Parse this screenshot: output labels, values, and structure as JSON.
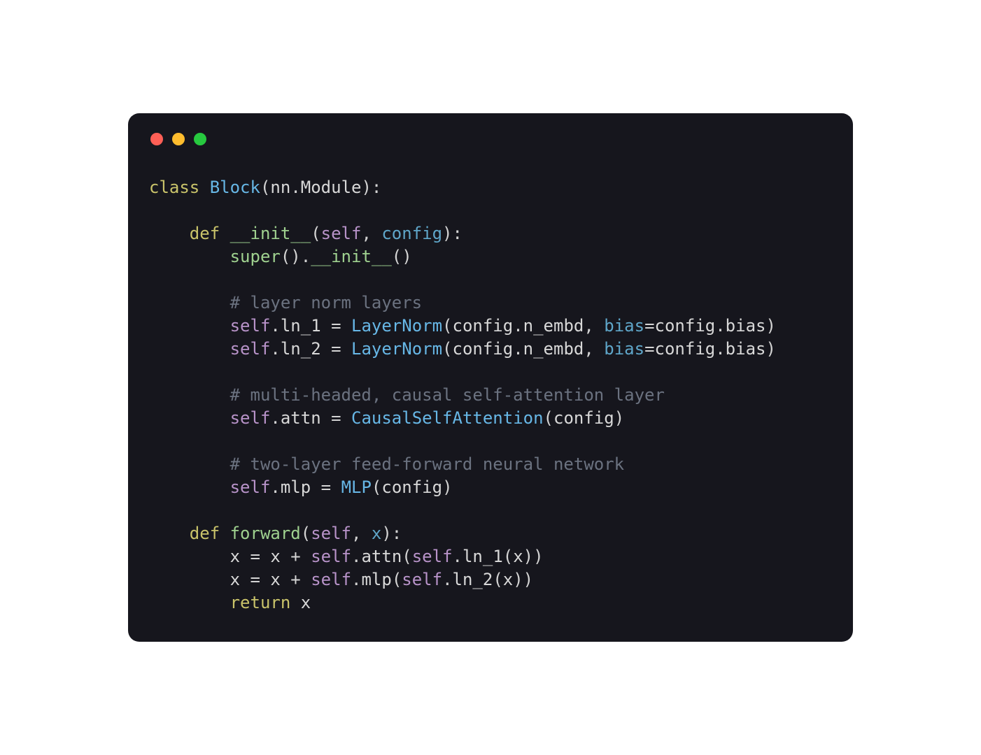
{
  "code": {
    "lines": [
      [
        {
          "t": "class ",
          "c": "kw"
        },
        {
          "t": "Block",
          "c": "cls"
        },
        {
          "t": "(",
          "c": "p"
        },
        {
          "t": "nn",
          "c": "nm"
        },
        {
          "t": ".",
          "c": "p"
        },
        {
          "t": "Module",
          "c": "nm"
        },
        {
          "t": "):",
          "c": "p"
        }
      ],
      [],
      [
        {
          "t": "    ",
          "c": "p"
        },
        {
          "t": "def ",
          "c": "kw"
        },
        {
          "t": "__init__",
          "c": "fn"
        },
        {
          "t": "(",
          "c": "p"
        },
        {
          "t": "self",
          "c": "slf"
        },
        {
          "t": ", ",
          "c": "p"
        },
        {
          "t": "config",
          "c": "prm"
        },
        {
          "t": "):",
          "c": "p"
        }
      ],
      [
        {
          "t": "        ",
          "c": "p"
        },
        {
          "t": "super",
          "c": "fn"
        },
        {
          "t": "().",
          "c": "p"
        },
        {
          "t": "__init__",
          "c": "fn"
        },
        {
          "t": "()",
          "c": "p"
        }
      ],
      [],
      [
        {
          "t": "        ",
          "c": "p"
        },
        {
          "t": "# layer norm layers",
          "c": "cm"
        }
      ],
      [
        {
          "t": "        ",
          "c": "p"
        },
        {
          "t": "self",
          "c": "slf"
        },
        {
          "t": ".",
          "c": "p"
        },
        {
          "t": "ln_1",
          "c": "nm"
        },
        {
          "t": " = ",
          "c": "op"
        },
        {
          "t": "LayerNorm",
          "c": "cls"
        },
        {
          "t": "(",
          "c": "p"
        },
        {
          "t": "config",
          "c": "nm"
        },
        {
          "t": ".",
          "c": "p"
        },
        {
          "t": "n_embd",
          "c": "nm"
        },
        {
          "t": ", ",
          "c": "p"
        },
        {
          "t": "bias",
          "c": "prm"
        },
        {
          "t": "=",
          "c": "op"
        },
        {
          "t": "config",
          "c": "nm"
        },
        {
          "t": ".",
          "c": "p"
        },
        {
          "t": "bias",
          "c": "nm"
        },
        {
          "t": ")",
          "c": "p"
        }
      ],
      [
        {
          "t": "        ",
          "c": "p"
        },
        {
          "t": "self",
          "c": "slf"
        },
        {
          "t": ".",
          "c": "p"
        },
        {
          "t": "ln_2",
          "c": "nm"
        },
        {
          "t": " = ",
          "c": "op"
        },
        {
          "t": "LayerNorm",
          "c": "cls"
        },
        {
          "t": "(",
          "c": "p"
        },
        {
          "t": "config",
          "c": "nm"
        },
        {
          "t": ".",
          "c": "p"
        },
        {
          "t": "n_embd",
          "c": "nm"
        },
        {
          "t": ", ",
          "c": "p"
        },
        {
          "t": "bias",
          "c": "prm"
        },
        {
          "t": "=",
          "c": "op"
        },
        {
          "t": "config",
          "c": "nm"
        },
        {
          "t": ".",
          "c": "p"
        },
        {
          "t": "bias",
          "c": "nm"
        },
        {
          "t": ")",
          "c": "p"
        }
      ],
      [],
      [
        {
          "t": "        ",
          "c": "p"
        },
        {
          "t": "# multi-headed, causal self-attention layer",
          "c": "cm"
        }
      ],
      [
        {
          "t": "        ",
          "c": "p"
        },
        {
          "t": "self",
          "c": "slf"
        },
        {
          "t": ".",
          "c": "p"
        },
        {
          "t": "attn",
          "c": "nm"
        },
        {
          "t": " = ",
          "c": "op"
        },
        {
          "t": "CausalSelfAttention",
          "c": "cls"
        },
        {
          "t": "(",
          "c": "p"
        },
        {
          "t": "config",
          "c": "nm"
        },
        {
          "t": ")",
          "c": "p"
        }
      ],
      [],
      [
        {
          "t": "        ",
          "c": "p"
        },
        {
          "t": "# two-layer feed-forward neural network",
          "c": "cm"
        }
      ],
      [
        {
          "t": "        ",
          "c": "p"
        },
        {
          "t": "self",
          "c": "slf"
        },
        {
          "t": ".",
          "c": "p"
        },
        {
          "t": "mlp",
          "c": "nm"
        },
        {
          "t": " = ",
          "c": "op"
        },
        {
          "t": "MLP",
          "c": "cls"
        },
        {
          "t": "(",
          "c": "p"
        },
        {
          "t": "config",
          "c": "nm"
        },
        {
          "t": ")",
          "c": "p"
        }
      ],
      [],
      [
        {
          "t": "    ",
          "c": "p"
        },
        {
          "t": "def ",
          "c": "kw"
        },
        {
          "t": "forward",
          "c": "fn"
        },
        {
          "t": "(",
          "c": "p"
        },
        {
          "t": "self",
          "c": "slf"
        },
        {
          "t": ", ",
          "c": "p"
        },
        {
          "t": "x",
          "c": "prm"
        },
        {
          "t": "):",
          "c": "p"
        }
      ],
      [
        {
          "t": "        ",
          "c": "p"
        },
        {
          "t": "x",
          "c": "nm"
        },
        {
          "t": " = ",
          "c": "op"
        },
        {
          "t": "x",
          "c": "nm"
        },
        {
          "t": " + ",
          "c": "op"
        },
        {
          "t": "self",
          "c": "slf"
        },
        {
          "t": ".",
          "c": "p"
        },
        {
          "t": "attn",
          "c": "nm"
        },
        {
          "t": "(",
          "c": "p"
        },
        {
          "t": "self",
          "c": "slf"
        },
        {
          "t": ".",
          "c": "p"
        },
        {
          "t": "ln_1",
          "c": "nm"
        },
        {
          "t": "(",
          "c": "p"
        },
        {
          "t": "x",
          "c": "nm"
        },
        {
          "t": "))",
          "c": "p"
        }
      ],
      [
        {
          "t": "        ",
          "c": "p"
        },
        {
          "t": "x",
          "c": "nm"
        },
        {
          "t": " = ",
          "c": "op"
        },
        {
          "t": "x",
          "c": "nm"
        },
        {
          "t": " + ",
          "c": "op"
        },
        {
          "t": "self",
          "c": "slf"
        },
        {
          "t": ".",
          "c": "p"
        },
        {
          "t": "mlp",
          "c": "nm"
        },
        {
          "t": "(",
          "c": "p"
        },
        {
          "t": "self",
          "c": "slf"
        },
        {
          "t": ".",
          "c": "p"
        },
        {
          "t": "ln_2",
          "c": "nm"
        },
        {
          "t": "(",
          "c": "p"
        },
        {
          "t": "x",
          "c": "nm"
        },
        {
          "t": "))",
          "c": "p"
        }
      ],
      [
        {
          "t": "        ",
          "c": "p"
        },
        {
          "t": "return ",
          "c": "kw"
        },
        {
          "t": "x",
          "c": "nm"
        }
      ]
    ]
  }
}
